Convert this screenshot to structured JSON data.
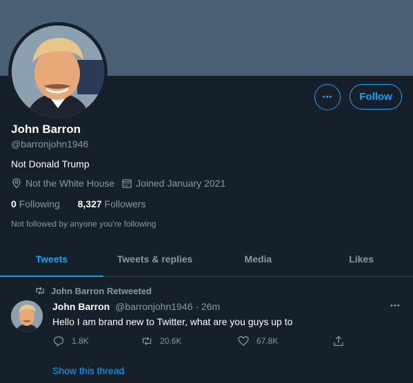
{
  "profile": {
    "display_name": "John Barron",
    "handle": "@barronjohn1946",
    "bio": "Not Donald Trump",
    "location": "Not the White House",
    "joined": "Joined January 2021",
    "following_count": "0",
    "following_label": "Following",
    "followers_count": "8,327",
    "followers_label": "Followers",
    "not_followed_note": "Not followed by anyone you're following",
    "follow_button": "Follow",
    "more_button": "•••"
  },
  "tabs": [
    {
      "label": "Tweets",
      "active": true
    },
    {
      "label": "Tweets & replies",
      "active": false
    },
    {
      "label": "Media",
      "active": false
    },
    {
      "label": "Likes",
      "active": false
    }
  ],
  "tweet": {
    "retweet_note": "John Barron Retweeted",
    "author_name": "John Barron",
    "author_handle": "@barronjohn1946",
    "separator": "·",
    "time": "26m",
    "more": "•••",
    "text": "Hello I am brand new to Twitter, what are you guys up to",
    "replies": "1.8K",
    "retweets": "20.6K",
    "likes": "67.8K",
    "show_thread": "Show this thread"
  },
  "colors": {
    "background": "#15202b",
    "banner": "#4a6075",
    "accent": "#1da1f2",
    "muted": "#8899a6",
    "divider": "#38444d"
  },
  "icons": {
    "location": "location-pin-icon",
    "calendar": "calendar-icon",
    "retweet": "retweet-icon",
    "reply": "reply-icon",
    "like": "heart-icon",
    "share": "share-icon"
  }
}
